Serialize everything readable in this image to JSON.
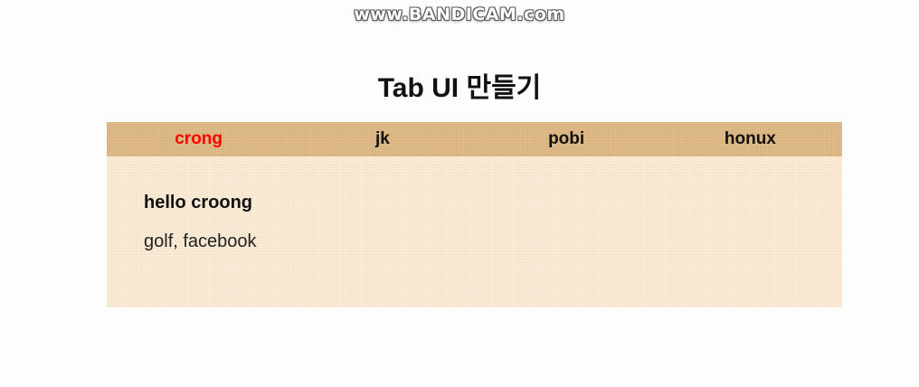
{
  "watermark": "www.BANDICAM.com",
  "page": {
    "title": "Tab UI 만들기"
  },
  "tabs": [
    {
      "label": "crong",
      "active": true
    },
    {
      "label": "jk",
      "active": false
    },
    {
      "label": "pobi",
      "active": false
    },
    {
      "label": "honux",
      "active": false
    }
  ],
  "panel": {
    "heading": "hello croong",
    "text": "golf, facebook"
  },
  "colors": {
    "tab_bar": "#d9b27c",
    "panel_bg": "#f6e5cc",
    "active_tab": "#ff0000"
  }
}
